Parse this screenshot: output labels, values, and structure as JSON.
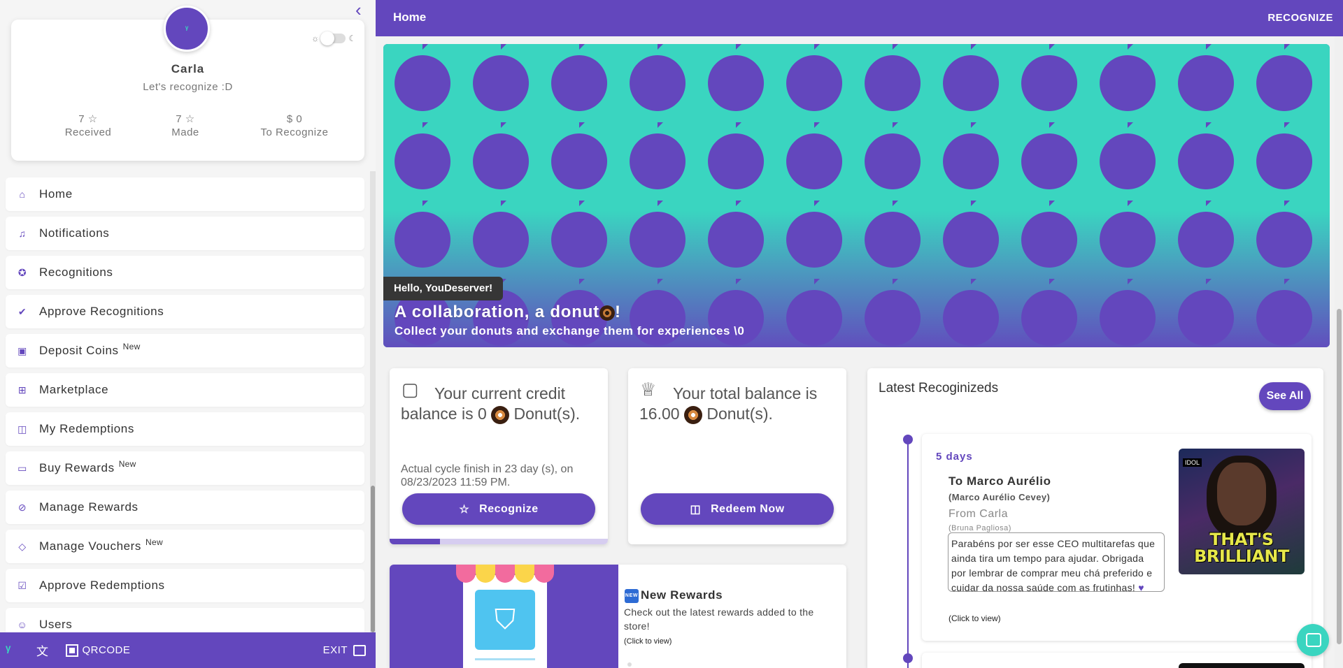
{
  "profile": {
    "avatar_initials": "ᵞ",
    "name": "Carla",
    "subtitle": "Let's recognize :D",
    "stats": [
      {
        "value": "7 ☆",
        "label": "Received"
      },
      {
        "value": "7 ☆",
        "label": "Made"
      },
      {
        "value": "$ 0",
        "label": "To Recognize"
      }
    ]
  },
  "sidebar": {
    "items": [
      {
        "label": "Home",
        "icon": "home-icon",
        "badge": ""
      },
      {
        "label": "Notifications",
        "icon": "bell-icon",
        "badge": ""
      },
      {
        "label": "Recognitions",
        "icon": "award-icon",
        "badge": ""
      },
      {
        "label": "Approve Recognitions",
        "icon": "check-double-icon",
        "badge": ""
      },
      {
        "label": "Deposit Coins",
        "icon": "money-icon",
        "badge": "New"
      },
      {
        "label": "Marketplace",
        "icon": "gift-icon",
        "badge": ""
      },
      {
        "label": "My Redemptions",
        "icon": "shopping-bag-icon",
        "badge": ""
      },
      {
        "label": "Buy Rewards",
        "icon": "wallet-icon",
        "badge": "New"
      },
      {
        "label": "Manage Rewards",
        "icon": "tag-icon",
        "badge": ""
      },
      {
        "label": "Manage Vouchers",
        "icon": "ticket-icon",
        "badge": "New"
      },
      {
        "label": "Approve Redemptions",
        "icon": "bag-check-icon",
        "badge": ""
      },
      {
        "label": "Users",
        "icon": "users-icon",
        "badge": ""
      }
    ]
  },
  "bottom_bar": {
    "qrcode": "QRCODE",
    "exit": "EXIT"
  },
  "topbar": {
    "title": "Home",
    "recognize": "RECOGNIZE"
  },
  "banner": {
    "hello": "Hello, YouDeserver!",
    "title": "A collaboration, a donut",
    "title_suffix": "!",
    "subtitle": "Collect your donuts and exchange them for experiences \\0"
  },
  "credit": {
    "text_a": "Your current credit balance is 0",
    "text_b": "Donut(s).",
    "cycle": "Actual cycle finish in 23 day (s), on 08/23/2023 11:59 PM.",
    "button": "Recognize",
    "progress": 0.23
  },
  "balance": {
    "text_a": "Your total balance is 16.00",
    "text_b": "Donut(s).",
    "button": "Redeem Now"
  },
  "new_rewards": {
    "title": "New Rewards",
    "badge": "NEW",
    "desc": "Check out the latest rewards added to the store!",
    "click": "(Click to view)"
  },
  "latest": {
    "title": "Latest Recoginizeds",
    "see_all": "See All",
    "item": {
      "days": "5 days",
      "to": "To Marco Aurélio",
      "to_full": "(Marco Aurélio Cevey)",
      "from": "From Carla",
      "from_full": "(Bruna Pagliosa)",
      "message": "Parabéns por ser esse CEO multitarefas que ainda tira um tempo para ajudar. Obrigada por lembrar de comprar meu chá preferido e cuidar da nossa saúde com as frutinhas!",
      "click": "(Click to view)",
      "gif_text": "THAT'S BRILLIANT",
      "gif_tag": "IDOL"
    }
  },
  "colors": {
    "primary": "#6347bd",
    "accent": "#3ad5c0"
  }
}
